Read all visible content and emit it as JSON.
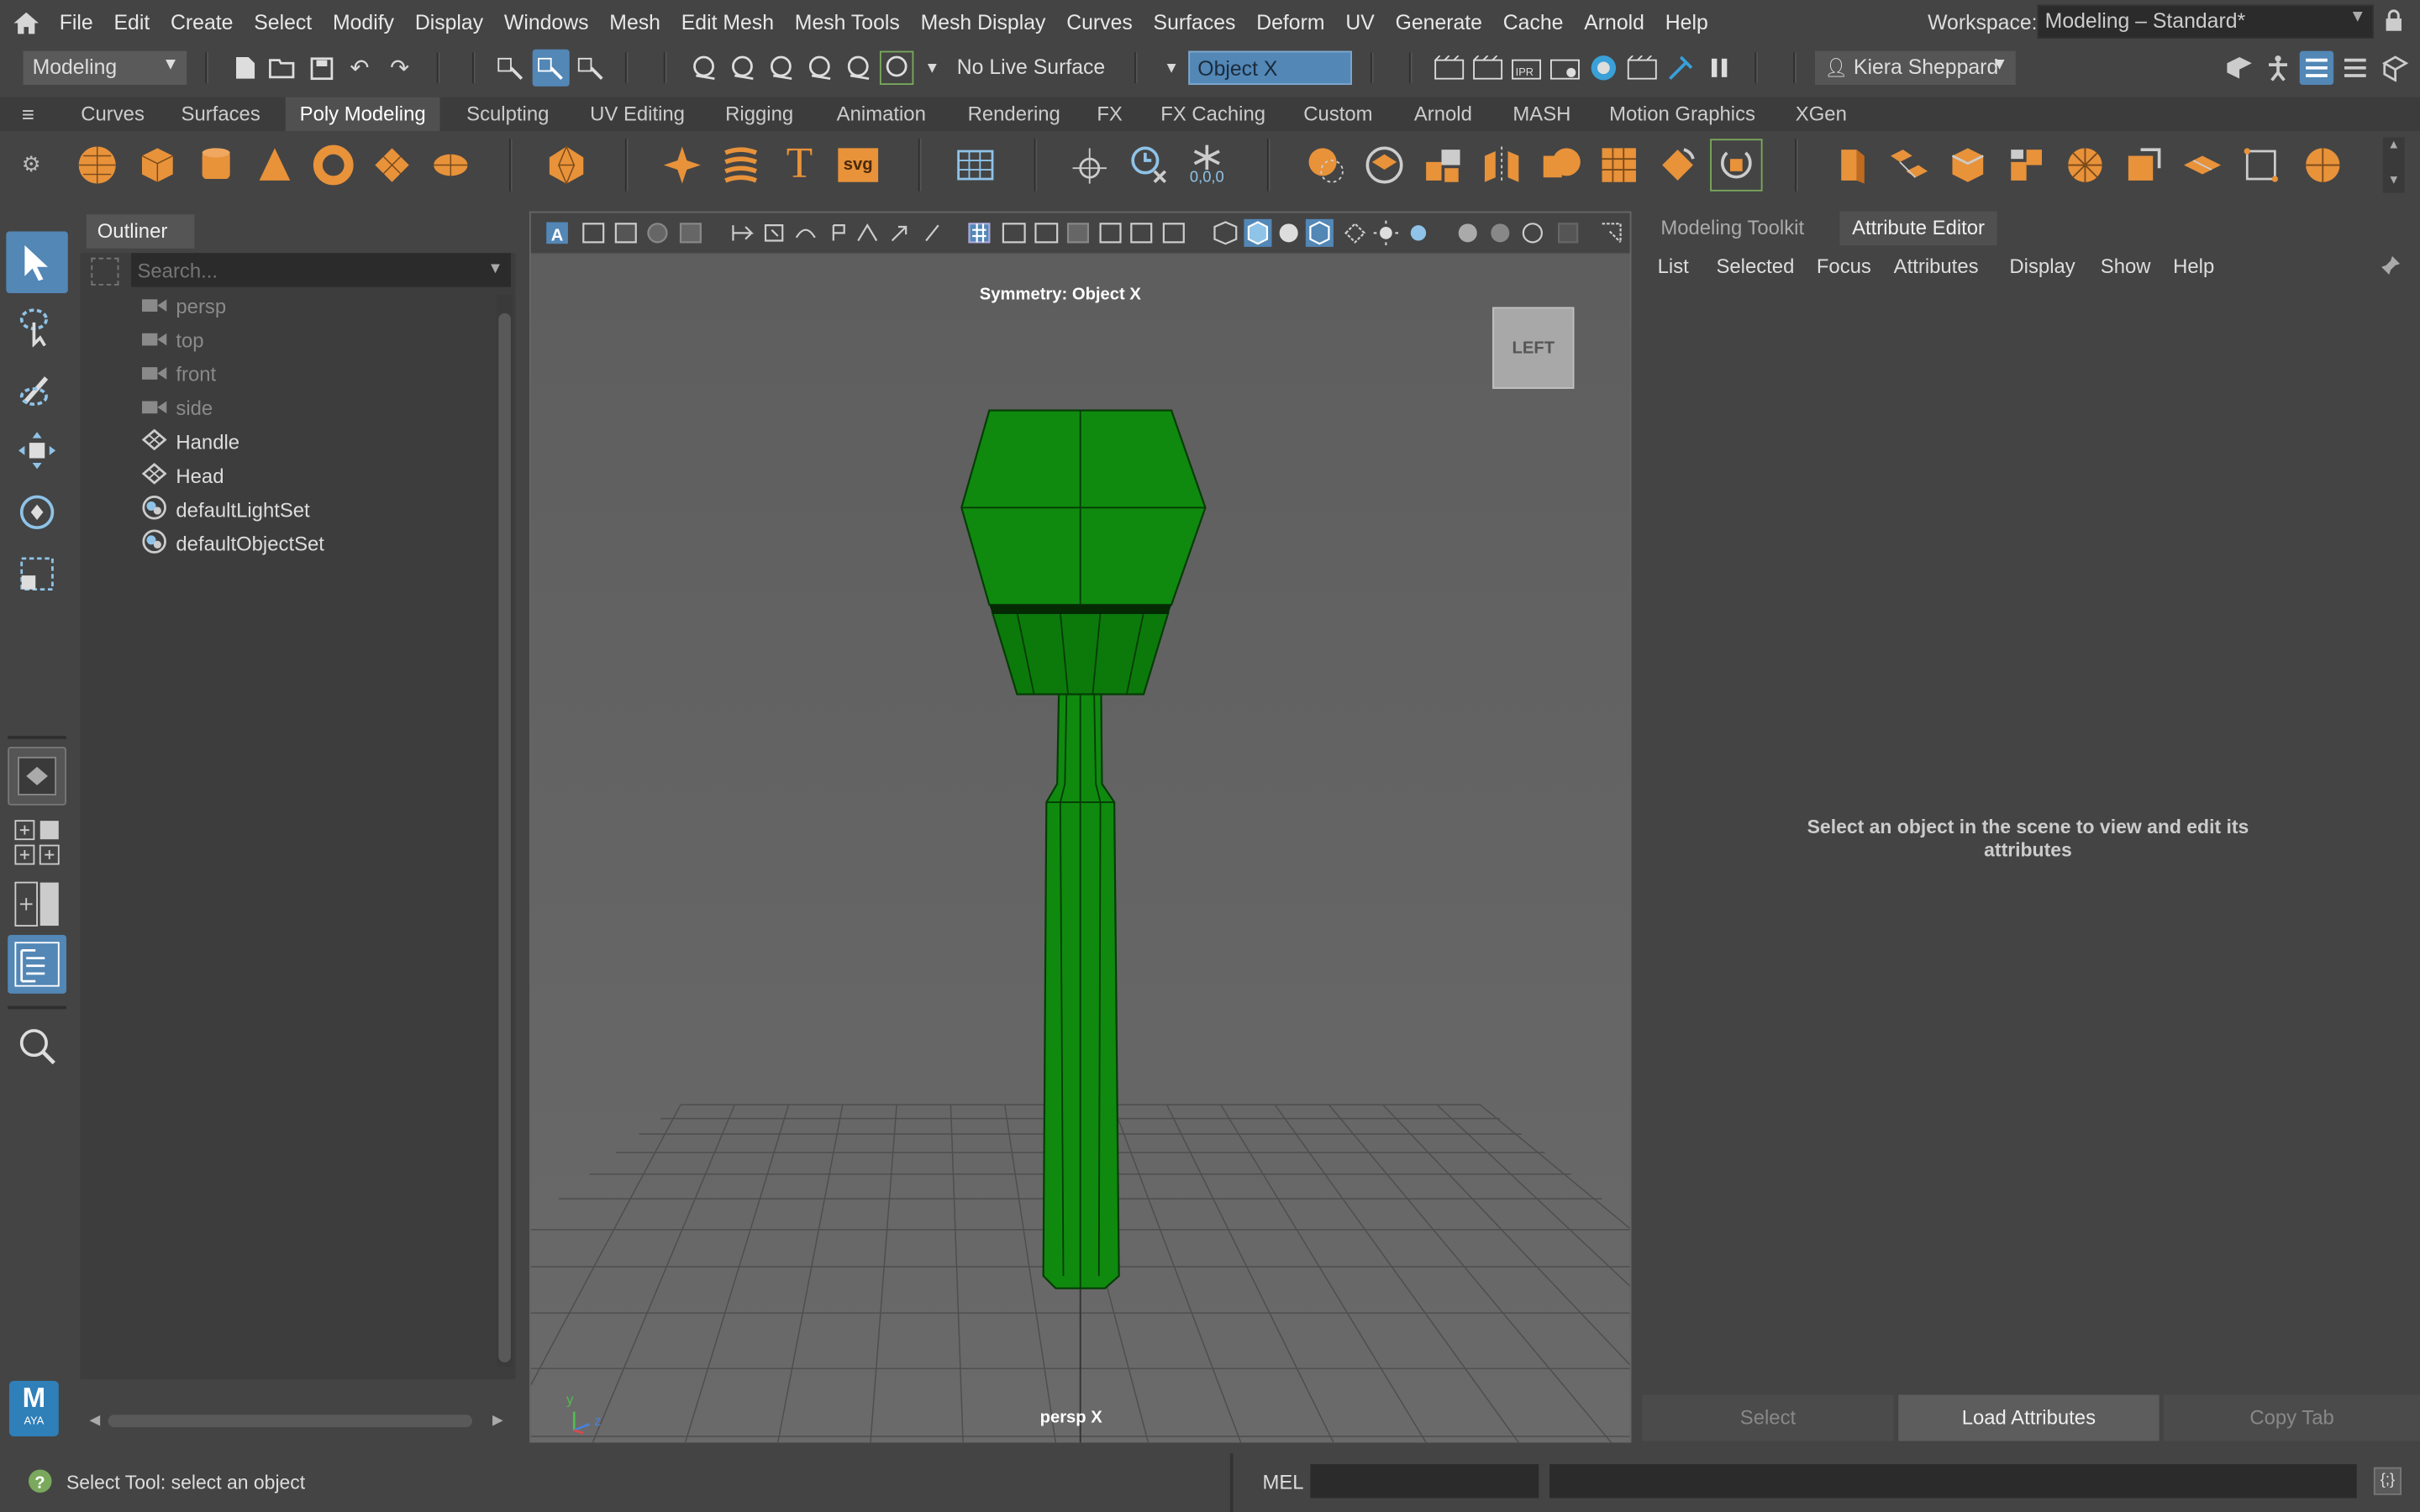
{
  "menubar": {
    "items": [
      "File",
      "Edit",
      "Create",
      "Select",
      "Modify",
      "Display",
      "Windows",
      "Mesh",
      "Edit Mesh",
      "Mesh Tools",
      "Mesh Display",
      "Curves",
      "Surfaces",
      "Deform",
      "UV",
      "Generate",
      "Cache",
      "Arnold",
      "Help"
    ],
    "workspace_label": "Workspace:",
    "workspace_value": "Modeling – Standard*"
  },
  "statusline": {
    "mode": "Modeling",
    "live_surface": "No Live Surface",
    "symmetry_field": "Object X",
    "user_name": "Kiera Sheppard"
  },
  "shelf": {
    "tabs": [
      "Curves",
      "Surfaces",
      "Poly Modeling",
      "Sculpting",
      "UV Editing",
      "Rigging",
      "Animation",
      "Rendering",
      "FX",
      "FX Caching",
      "Custom",
      "Arnold",
      "MASH",
      "Motion Graphics",
      "XGen"
    ],
    "active_tab": "Poly Modeling",
    "svg_label": "svg",
    "text_glyph": "T",
    "origin_label": "0,0,0"
  },
  "outliner": {
    "title": "Outliner",
    "search_placeholder": "Search...",
    "items": [
      {
        "label": "persp",
        "icon": "camera-icon",
        "dim": true
      },
      {
        "label": "top",
        "icon": "camera-icon",
        "dim": true
      },
      {
        "label": "front",
        "icon": "camera-icon",
        "dim": true
      },
      {
        "label": "side",
        "icon": "camera-icon",
        "dim": true
      },
      {
        "label": "Handle",
        "icon": "mesh-icon",
        "dim": false
      },
      {
        "label": "Head",
        "icon": "mesh-icon",
        "dim": false
      },
      {
        "label": "defaultLightSet",
        "icon": "set-icon",
        "dim": false
      },
      {
        "label": "defaultObjectSet",
        "icon": "set-icon",
        "dim": false
      }
    ]
  },
  "viewport": {
    "symmetry_label": "Symmetry: Object X",
    "viewcube_label": "LEFT",
    "camera_label": "persp X",
    "axis_y": "y",
    "axis_z": "z",
    "model_color": "#0f8a0f"
  },
  "right_panel": {
    "tabs": [
      "Modeling Toolkit",
      "Attribute Editor"
    ],
    "active_tab": "Attribute Editor",
    "menus": [
      "List",
      "Selected",
      "Focus",
      "Attributes",
      "Display",
      "Show",
      "Help"
    ],
    "empty_message": "Select an object in the scene to view and edit its attributes",
    "buttons": {
      "select": "Select",
      "load": "Load Attributes",
      "copy": "Copy Tab"
    }
  },
  "bottom": {
    "help_text": "Select Tool: select an object",
    "mel_label": "MEL"
  },
  "badge": {
    "logo_letter": "M",
    "logo_sub": "AYA"
  },
  "colors": {
    "accent": "#5287b6",
    "shelf_icon": "#e8923a"
  }
}
